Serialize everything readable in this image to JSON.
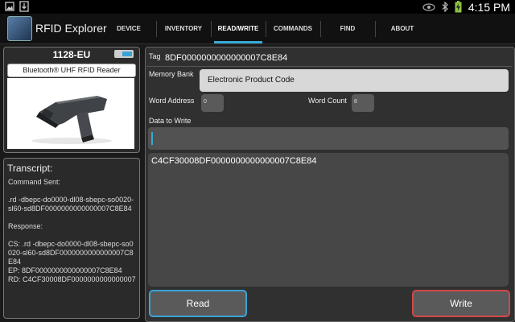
{
  "status_bar": {
    "time": "4:15 PM",
    "icons": [
      "image-icon",
      "download-icon",
      "eye-icon",
      "bluetooth-icon",
      "battery-charging-icon"
    ]
  },
  "app": {
    "title": "RFID Explorer",
    "tabs": [
      {
        "label": "DEVICE",
        "active": false
      },
      {
        "label": "INVENTORY",
        "active": false
      },
      {
        "label": "READ/WRITE",
        "active": true
      },
      {
        "label": "COMMANDS",
        "active": false
      },
      {
        "label": "FIND",
        "active": false
      },
      {
        "label": "ABOUT",
        "active": false
      }
    ]
  },
  "device": {
    "name": "1128-EU",
    "description": "Bluetooth® UHF RFID Reader"
  },
  "transcript": {
    "title": "Transcript:",
    "command_sent_label": "Command Sent:",
    "command": ".rd -dbepc-do0000-dl08-sbepc-so0020-sl60-sd8DF0000000000000007C8E84",
    "response_label": "Response:",
    "response_cs": "CS: .rd -dbepc-do0000-dl08-sbepc-so0020-sl60-sd8DF0000000000000007C8E84",
    "response_ep": "EP: 8DF0000000000000007C8E84",
    "response_rd": "RD: C4CF30008DF0000000000000007"
  },
  "form": {
    "tag_label": "Tag",
    "tag_value": "8DF0000000000000007C8E84",
    "memory_bank_label": "Memory Bank",
    "memory_bank_value": "Electronic Product Code",
    "word_address_label": "Word Address",
    "word_address_value": "0",
    "word_count_label": "Word Count",
    "word_count_value": "8",
    "data_to_write_label": "Data to Write",
    "data_to_write_value": "",
    "result_value": "C4CF30008DF0000000000000007C8E84"
  },
  "buttons": {
    "read": "Read",
    "write": "Write"
  },
  "colors": {
    "accent_blue": "#36a9d6",
    "write_red": "#d24848"
  }
}
